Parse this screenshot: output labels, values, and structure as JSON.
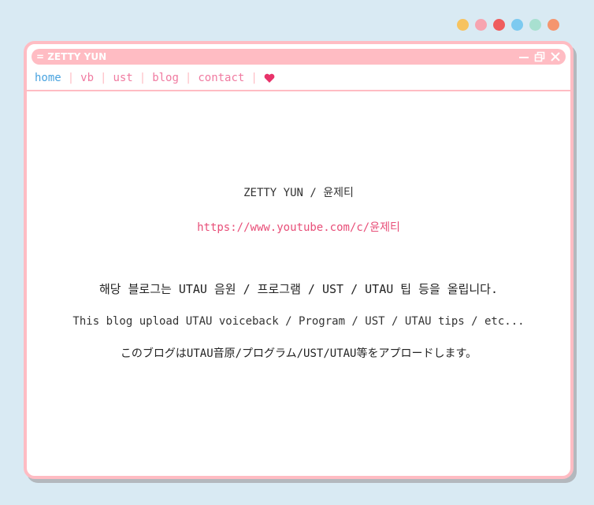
{
  "dots": [
    "#f7c35f",
    "#f7a4b0",
    "#ef5d5d",
    "#7ccaf0",
    "#a8e0d0",
    "#f5956e"
  ],
  "window": {
    "title": "= ZETTY YUN",
    "accent": "#ffbcc3"
  },
  "nav": {
    "items": [
      "home",
      "vb",
      "ust",
      "blog",
      "contact"
    ],
    "separator": "|",
    "link_color": "#f07aa0",
    "heart_color": "#e8336a"
  },
  "content": {
    "name": "ZETTY YUN / 윤제티",
    "url": "https://www.youtube.com/c/윤제티",
    "desc_ko": "해당 블로그는 UTAU 음원 / 프로그램 / UST / UTAU 팁 등을 올립니다.",
    "desc_en": "This blog upload UTAU voiceback / Program / UST / UTAU tips / etc...",
    "desc_ja": "このブログはUTAU音原/プログラム/UST/UTAU等をアプロードします。"
  }
}
